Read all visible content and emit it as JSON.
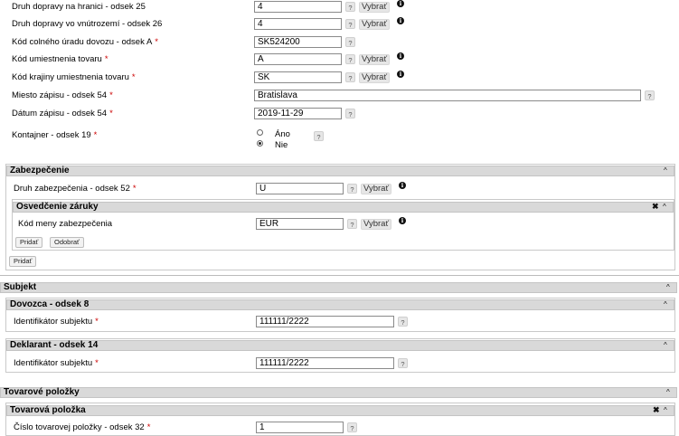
{
  "header_fields": {
    "druh_hranice": {
      "label": "Druh dopravy na hranici - odsek 25",
      "value": "4",
      "select": "Vybrať",
      "help": "?"
    },
    "druh_vnutro": {
      "label": "Druh dopravy vo vnútrozemí - odsek 26",
      "value": "4",
      "select": "Vybrať",
      "help": "?"
    },
    "kod_uradu": {
      "label": "Kód colného úradu dovozu - odsek A",
      "required": "*",
      "value": "SK524200",
      "help": "?"
    },
    "kod_umiestnenia": {
      "label": "Kód umiestnenia tovaru",
      "required": "*",
      "value": "A",
      "select": "Vybrať",
      "help": "?"
    },
    "kod_krajiny": {
      "label": "Kód krajiny umiestnenia tovaru",
      "required": "*",
      "value": "SK",
      "select": "Vybrať",
      "help": "?"
    },
    "miesto_zapisu": {
      "label": "Miesto zápisu - odsek 54",
      "required": "*",
      "value": "Bratislava",
      "help": "?"
    },
    "datum_zapisu": {
      "label": "Dátum zápisu - odsek 54",
      "required": "*",
      "value": "2019-11-29",
      "help": "?"
    },
    "kontajner": {
      "label": "Kontajner - odsek 19",
      "required": "*",
      "option_yes": "Áno",
      "option_no": "Nie",
      "selected": "Nie",
      "help": "?"
    }
  },
  "zabezpecenie": {
    "title": "Zabezpečenie",
    "druh_label": "Druh zabezpečenia - odsek 52",
    "required": "*",
    "druh_value": "U",
    "select": "Vybrať",
    "help": "?",
    "osvedcenie": {
      "title": "Osvedčenie záruky",
      "kod_meny_label": "Kód meny zabezpečenia",
      "kod_meny_value": "EUR",
      "select": "Vybrať",
      "help": "?",
      "add_label": "Pridať",
      "remove_label": "Odobrať"
    },
    "add_label": "Pridať"
  },
  "subjekt": {
    "title": "Subjekt",
    "dovozca": {
      "title": "Dovozca - odsek 8",
      "label": "Identifikátor subjektu",
      "required": "*",
      "value": "111111/2222",
      "help": "?"
    },
    "deklarant": {
      "title": "Deklarant - odsek 14",
      "label": "Identifikátor subjektu",
      "required": "*",
      "value": "111111/2222",
      "help": "?"
    }
  },
  "tovarove_polozky": {
    "title": "Tovarové položky",
    "polozka": {
      "title": "Tovarová položka",
      "label": "Číslo tovarovej položky - odsek 32",
      "required": "*",
      "value": "1",
      "help": "?"
    }
  },
  "icons": {
    "info": "i",
    "collapse": "^",
    "close": "✖"
  }
}
